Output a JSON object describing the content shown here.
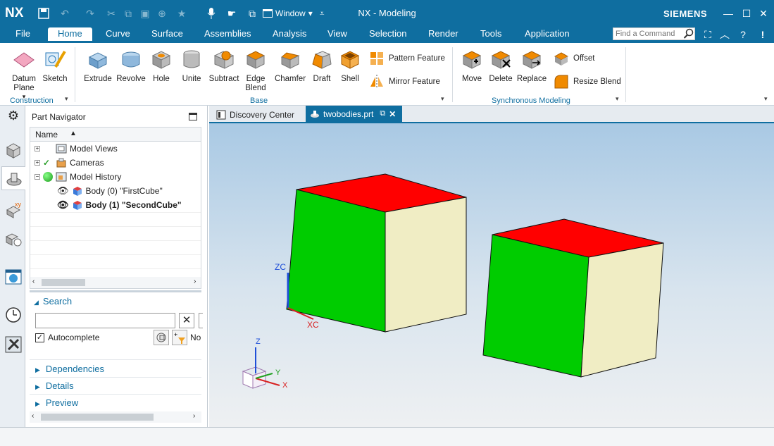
{
  "titlebar": {
    "logo": "NX",
    "window_label": "Window",
    "title": "NX - Modeling",
    "brand": "SIEMENS"
  },
  "menu": {
    "items": [
      "File",
      "Home",
      "Curve",
      "Surface",
      "Assemblies",
      "Analysis",
      "View",
      "Selection",
      "Render",
      "Tools",
      "Application"
    ],
    "active": "Home",
    "search_placeholder": "Find a Command"
  },
  "ribbon": {
    "construction": {
      "datum_plane": "Datum Plane",
      "sketch": "Sketch",
      "label": "Construction"
    },
    "base": {
      "buttons": [
        "Extrude",
        "Revolve",
        "Hole",
        "Unite",
        "Subtract",
        "Edge Blend",
        "Chamfer",
        "Draft",
        "Shell"
      ],
      "pattern_feature": "Pattern Feature",
      "mirror_feature": "Mirror Feature",
      "label": "Base"
    },
    "synchronous": {
      "buttons": [
        "Move",
        "Delete",
        "Replace"
      ],
      "offset": "Offset",
      "resize_blend": "Resize Blend",
      "label": "Synchronous Modeling"
    }
  },
  "navigator": {
    "title": "Part Navigator",
    "column_name": "Name",
    "tree": [
      {
        "label": "Model Views",
        "level": 0
      },
      {
        "label": "Cameras",
        "level": 0
      },
      {
        "label": "Model History",
        "level": 0
      },
      {
        "label": "Body (0) \"FirstCube\"",
        "level": 1
      },
      {
        "label": "Body (1) \"SecondCube\"",
        "level": 1
      }
    ],
    "search_title": "Search",
    "autocomplete": "Autocomplete",
    "no_label": "No",
    "dependencies": "Dependencies",
    "details": "Details",
    "preview": "Preview"
  },
  "tabs": [
    {
      "label": "Discovery Center"
    },
    {
      "label": "twobodies.prt"
    }
  ],
  "viewport": {
    "axis_zc": "ZC",
    "axis_xc": "XC",
    "triad_z": "Z",
    "triad_y": "Y",
    "triad_x": "X",
    "colors": {
      "top": "#ff0000",
      "front": "#00cc00",
      "side": "#f0edc4"
    }
  }
}
